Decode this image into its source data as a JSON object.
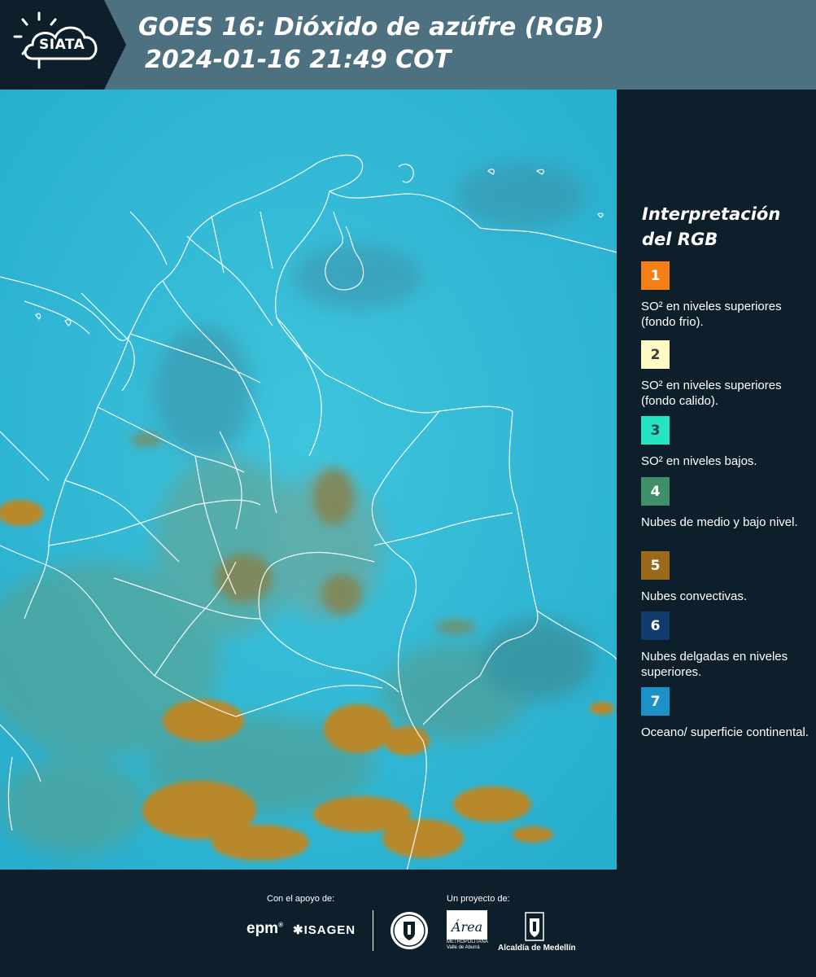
{
  "header": {
    "logo_text": "SIATA",
    "title_line1": "GOES 16: Dióxido de azúfre (RGB)",
    "title_line2": "2024-01-16 21:49 COT"
  },
  "legend": {
    "title_line1": "Interpretación",
    "title_line2": "del RGB",
    "items": [
      {
        "number": "1",
        "color": "#f57f17",
        "text_color": "#ffffff",
        "text": "SO² en niveles superiores (fondo frio)."
      },
      {
        "number": "2",
        "color": "#fff9c4",
        "text_color": "#3a3a3a",
        "text": "SO² en niveles superiores (fondo calido)."
      },
      {
        "number": "3",
        "color": "#26e3c4",
        "text_color": "#1b4a4a",
        "text": "SO² en niveles bajos."
      },
      {
        "number": "4",
        "color": "#3f8f6a",
        "text_color": "#ffffff",
        "text": "Nubes de medio y bajo nivel."
      },
      {
        "number": "5",
        "color": "#9a6a1a",
        "text_color": "#ffffff",
        "text": "Nubes convectivas."
      },
      {
        "number": "6",
        "color": "#0f3b6d",
        "text_color": "#ffffff",
        "text": "Nubes delgadas en niveles superiores."
      },
      {
        "number": "7",
        "color": "#1e90c8",
        "text_color": "#ffffff",
        "text": "Oceano/ superficie continental."
      }
    ]
  },
  "map": {
    "ocean_color": "#2bb6d4",
    "land_color": "#3fc6dc",
    "convective_color": "#b8882a",
    "cloud_color": "#6aa88c",
    "border_color": "#ffffff"
  },
  "footer": {
    "support_label": "Con el apoyo de:",
    "project_label": "Un proyecto de:",
    "sponsor1": "epm",
    "sponsor2": "ISAGEN",
    "area_logo_text": "Área",
    "area_sub": "METROPOLITANA Valle de Aburrá",
    "alcaldia": "Alcaldía de Medellín"
  }
}
